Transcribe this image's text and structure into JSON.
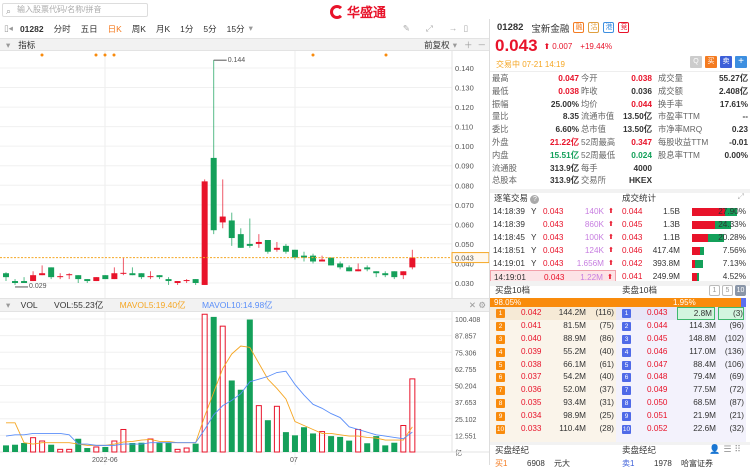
{
  "search": {
    "placeholder": "输入股票代码/名称/拼音"
  },
  "logo": {
    "text": "华盛通"
  },
  "toolbar": {
    "code": "01282",
    "periods": [
      "分时",
      "五日",
      "日K",
      "周K",
      "月K",
      "1分",
      "5分",
      "15分"
    ],
    "active": "日K"
  },
  "indicator": {
    "label": "指标",
    "adjust": "前复权"
  },
  "price_axis": {
    "ticks": [
      "0.140",
      "0.130",
      "0.120",
      "0.110",
      "0.100",
      "0.090",
      "0.080",
      "0.070",
      "0.060",
      "0.050",
      "0.040",
      "0.030"
    ],
    "current": "0.043",
    "max_label": "0.144",
    "min_label": "0.029"
  },
  "vol_header": {
    "label": "VOL",
    "vol": "VOL:55.23亿",
    "ma5": "MAVOL5:19.40亿",
    "ma10": "MAVOL10:14.98亿"
  },
  "vol_axis": {
    "ticks": [
      "100.408",
      "87.857",
      "75.306",
      "62.755",
      "50.204",
      "37.653",
      "25.102",
      "12.551",
      "亿"
    ]
  },
  "date_axis": [
    "2022-06",
    "07"
  ],
  "colors": {
    "up": "#e8132a",
    "down": "#14a05a",
    "ma5": "#f5a623",
    "ma10": "#5b8ff9",
    "accent": "#f47b20"
  },
  "chart_data": {
    "type": "candlestick",
    "price_range": [
      0.0265,
      0.146
    ],
    "candles": [
      [
        0.035,
        0.033,
        0.0355,
        0.031
      ],
      [
        0.031,
        0.03,
        0.032,
        0.029
      ],
      [
        0.031,
        0.03,
        0.033,
        0.03
      ],
      [
        0.031,
        0.034,
        0.036,
        0.031
      ],
      [
        0.034,
        0.035,
        0.039,
        0.034
      ],
      [
        0.038,
        0.033,
        0.038,
        0.032
      ],
      [
        0.033,
        0.0335,
        0.035,
        0.032
      ],
      [
        0.034,
        0.0345,
        0.035,
        0.032
      ],
      [
        0.034,
        0.032,
        0.034,
        0.03
      ],
      [
        0.032,
        0.031,
        0.032,
        0.03
      ],
      [
        0.031,
        0.033,
        0.033,
        0.031
      ],
      [
        0.034,
        0.032,
        0.034,
        0.032
      ],
      [
        0.032,
        0.035,
        0.038,
        0.032
      ],
      [
        0.035,
        0.0352,
        0.043,
        0.034
      ],
      [
        0.035,
        0.034,
        0.038,
        0.034
      ],
      [
        0.035,
        0.033,
        0.035,
        0.032
      ],
      [
        0.033,
        0.0335,
        0.036,
        0.032
      ],
      [
        0.034,
        0.033,
        0.034,
        0.032
      ],
      [
        0.032,
        0.031,
        0.033,
        0.029
      ],
      [
        0.03,
        0.031,
        0.031,
        0.029
      ],
      [
        0.031,
        0.0315,
        0.032,
        0.03
      ],
      [
        0.032,
        0.03,
        0.032,
        0.029
      ],
      [
        0.029,
        0.082,
        0.083,
        0.029
      ],
      [
        0.094,
        0.057,
        0.144,
        0.055
      ],
      [
        0.061,
        0.064,
        0.083,
        0.058
      ],
      [
        0.062,
        0.053,
        0.066,
        0.049
      ],
      [
        0.055,
        0.048,
        0.058,
        0.048
      ],
      [
        0.05,
        0.049,
        0.063,
        0.048
      ],
      [
        0.05,
        0.051,
        0.055,
        0.048
      ],
      [
        0.052,
        0.046,
        0.052,
        0.045
      ],
      [
        0.047,
        0.048,
        0.051,
        0.046
      ],
      [
        0.049,
        0.046,
        0.05,
        0.045
      ],
      [
        0.047,
        0.043,
        0.047,
        0.042
      ],
      [
        0.044,
        0.043,
        0.046,
        0.041
      ],
      [
        0.044,
        0.041,
        0.045,
        0.04
      ],
      [
        0.041,
        0.042,
        0.044,
        0.041
      ],
      [
        0.043,
        0.039,
        0.043,
        0.039
      ],
      [
        0.04,
        0.038,
        0.041,
        0.037
      ],
      [
        0.038,
        0.036,
        0.039,
        0.036
      ],
      [
        0.036,
        0.037,
        0.04,
        0.036
      ],
      [
        0.038,
        0.037,
        0.039,
        0.036
      ],
      [
        0.036,
        0.035,
        0.036,
        0.033
      ],
      [
        0.035,
        0.034,
        0.036,
        0.033
      ],
      [
        0.036,
        0.033,
        0.036,
        0.032
      ],
      [
        0.034,
        0.036,
        0.036,
        0.032
      ],
      [
        0.038,
        0.043,
        0.047,
        0.037
      ]
    ],
    "volume_range": [
      0,
      104
    ],
    "volume": [
      5,
      5.5,
      6.8,
      10.8,
      8.3,
      5.5,
      2,
      2,
      10,
      3,
      3.8,
      3.8,
      8.3,
      17,
      6.8,
      7,
      9.8,
      7.3,
      7.3,
      2,
      3,
      6.3,
      104,
      102,
      95,
      54,
      47,
      100,
      35,
      24,
      34.5,
      15,
      12.6,
      18.7,
      14,
      15.4,
      12,
      11.4,
      8.6,
      17,
      6.6,
      12,
      5,
      7,
      20,
      55.2
    ],
    "mavol5": [
      22,
      22,
      7,
      6,
      7,
      7,
      7,
      7,
      6,
      5,
      5,
      5,
      6,
      7.5,
      8,
      9,
      9.5,
      8,
      8,
      7,
      7,
      7,
      27,
      45,
      63,
      74,
      80,
      79,
      67,
      55,
      48,
      40,
      23,
      20,
      17,
      14,
      14,
      13,
      12,
      12,
      11,
      10.5,
      9,
      9,
      9,
      19
    ],
    "mavol10": [
      12,
      13,
      13,
      14,
      14,
      14,
      14,
      13,
      6,
      6,
      5,
      5,
      5,
      6,
      6,
      6,
      7,
      7,
      7,
      7,
      7,
      7,
      17,
      28,
      35,
      39,
      44,
      53,
      55,
      57,
      60,
      61,
      51,
      43,
      36,
      33,
      29,
      26,
      19,
      17,
      15,
      13,
      12,
      11,
      10,
      15
    ]
  },
  "quote": {
    "code": "01282",
    "name": "宝新金融",
    "badges": [
      "融",
      "沽",
      "港",
      "竞"
    ],
    "price": "0.043",
    "change": "0.007",
    "pct": "+19.44%",
    "status": "交易中 07-21 14:19",
    "buttons": [
      "Q",
      "买",
      "卖",
      "+"
    ]
  },
  "stats": [
    [
      [
        "最高",
        "0.047",
        "r"
      ],
      [
        "今开",
        "0.038",
        "r"
      ],
      [
        "成交量",
        "55.27亿",
        ""
      ]
    ],
    [
      [
        "最低",
        "0.038",
        "r"
      ],
      [
        "昨收",
        "0.036",
        ""
      ],
      [
        "成交额",
        "2.408亿",
        ""
      ]
    ],
    [
      [
        "振幅",
        "25.00%",
        ""
      ],
      [
        "均价",
        "0.044",
        "r"
      ],
      [
        "换手率",
        "17.61%",
        ""
      ]
    ],
    [
      [
        "量比",
        "8.35",
        ""
      ],
      [
        "流通市值",
        "13.50亿",
        ""
      ],
      [
        "市盈率TTM",
        "--",
        ""
      ]
    ],
    [
      [
        "委比",
        "6.60%",
        ""
      ],
      [
        "总市值",
        "13.50亿",
        ""
      ],
      [
        "市净率MRQ",
        "0.23",
        ""
      ]
    ],
    [
      [
        "外盘",
        "21.22亿",
        "r"
      ],
      [
        "52周最高",
        "0.347",
        "r"
      ],
      [
        "每股收益TTM",
        "-0.01",
        ""
      ]
    ],
    [
      [
        "内盘",
        "15.51亿",
        "g"
      ],
      [
        "52周最低",
        "0.024",
        "g"
      ],
      [
        "股息率TTM",
        "0.00%",
        ""
      ]
    ],
    [
      [
        "流通股",
        "313.9亿",
        ""
      ],
      [
        "每手",
        "4000",
        ""
      ]
    ],
    [
      [
        "总股本",
        "313.9亿",
        ""
      ],
      [
        "交易所",
        "HKEX",
        ""
      ]
    ]
  ],
  "ticks": {
    "title": "逐笔交易",
    "rows": [
      [
        "14:18:39",
        "Y",
        "0.043",
        "140K"
      ],
      [
        "14:18:39",
        "",
        "0.043",
        "860K"
      ],
      [
        "14:18:45",
        "Y",
        "0.043",
        "100K"
      ],
      [
        "14:18:51",
        "Y",
        "0.043",
        "124K"
      ],
      [
        "14:19:01",
        "Y",
        "0.043",
        "1.656M"
      ],
      [
        "14:19:01",
        "",
        "0.043",
        "1.22M"
      ]
    ]
  },
  "volstats": {
    "title": "成交统计",
    "rows": [
      [
        "0.044",
        "1.5B",
        "27.90%",
        0.279,
        0.75
      ],
      [
        "0.045",
        "1.3B",
        "24.33%",
        0.243,
        0.6
      ],
      [
        "0.043",
        "1.1B",
        "20.28%",
        0.203,
        0.5
      ],
      [
        "0.046",
        "417.4M",
        "7.56%",
        0.0756,
        0.7
      ],
      [
        "0.042",
        "393.8M",
        "7.13%",
        0.0713,
        0.25
      ],
      [
        "0.041",
        "249.9M",
        "4.52%",
        0.0452,
        0.7
      ]
    ]
  },
  "book": {
    "bid_title": "买盘10档",
    "ask_title": "卖盘10档",
    "levels": [
      "1",
      "5",
      "10"
    ],
    "bid_pct": "98.05%",
    "ask_pct": "1.95%",
    "bid_ratio": 0.9805,
    "bids": [
      [
        "1",
        "0.042",
        "144.2M",
        "(116)"
      ],
      [
        "2",
        "0.041",
        "81.5M",
        "(75)"
      ],
      [
        "3",
        "0.040",
        "88.9M",
        "(86)"
      ],
      [
        "4",
        "0.039",
        "55.2M",
        "(40)"
      ],
      [
        "5",
        "0.038",
        "66.1M",
        "(61)"
      ],
      [
        "6",
        "0.037",
        "54.2M",
        "(40)"
      ],
      [
        "7",
        "0.036",
        "52.0M",
        "(37)"
      ],
      [
        "8",
        "0.035",
        "93.4M",
        "(31)"
      ],
      [
        "9",
        "0.034",
        "98.9M",
        "(25)"
      ],
      [
        "10",
        "0.033",
        "110.4M",
        "(28)"
      ]
    ],
    "asks": [
      [
        "1",
        "0.043",
        "2.8M",
        "(3)"
      ],
      [
        "2",
        "0.044",
        "114.3M",
        "(96)"
      ],
      [
        "3",
        "0.045",
        "148.8M",
        "(102)"
      ],
      [
        "4",
        "0.046",
        "117.0M",
        "(136)"
      ],
      [
        "5",
        "0.047",
        "88.4M",
        "(106)"
      ],
      [
        "6",
        "0.048",
        "79.4M",
        "(69)"
      ],
      [
        "7",
        "0.049",
        "77.5M",
        "(72)"
      ],
      [
        "8",
        "0.050",
        "68.5M",
        "(87)"
      ],
      [
        "9",
        "0.051",
        "21.9M",
        "(21)"
      ],
      [
        "10",
        "0.052",
        "22.6M",
        "(32)"
      ]
    ]
  },
  "brokers": {
    "bid_title": "买盘经纪",
    "ask_title": "卖盘经纪",
    "bid_row": [
      "买1",
      "6908",
      "元大"
    ],
    "ask_row": [
      "卖1",
      "1978",
      "哈富证券"
    ]
  }
}
